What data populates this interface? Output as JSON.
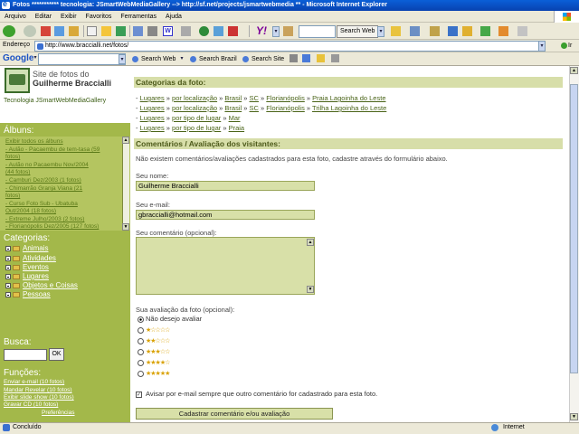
{
  "window": {
    "title": "Fotos *********** tecnologia: JSmartWebMediaGallery --> http://sf.net/projects/jsmartwebmedia ** - Microsoft Internet Explorer"
  },
  "menu": [
    "Arquivo",
    "Editar",
    "Exibir",
    "Favoritos",
    "Ferramentas",
    "Ajuda"
  ],
  "toolbar": {
    "search_button": "Search Web"
  },
  "address": {
    "label": "Endereço",
    "url": "http://www.braccialli.net/fotos/",
    "go": "Ir"
  },
  "googlebar": {
    "logo": "Google",
    "search_web": "Search Web",
    "search_brazil": "Search Brazil",
    "search_site": "Search Site"
  },
  "sidebar": {
    "site_title_line1": "Site de fotos do",
    "site_title_line2": "Guilherme Braccialli",
    "tech": "Tecnologia JSmartWebMediaGallery",
    "albums_head": "Álbuns:",
    "albums": [
      "Exibir todos os álbuns",
      "- Aulão - Pacaembu de tem-tasa (59",
      "fotos)",
      "- Aulão no Pacaembu Nov/2004",
      "(44 fotos)",
      "- Camburi Dez/2003 (1 fotos)",
      "- Chimarrão Granja Viana (21",
      "fotos)",
      "- Curso Foto Sub - Ubatuba",
      "Out/2004 (18 fotos)",
      "- Extreme Julho/2003 (2 fotos)",
      "- Florianópolis Dez/2005 (127 fotos)"
    ],
    "categories_head": "Categorias:",
    "categories": [
      "Animais",
      "Atividades",
      "Eventos",
      "Lugares",
      "Objetos e Coisas",
      "Pessoas"
    ],
    "search_head": "Busca:",
    "ok": "OK",
    "functions_head": "Funções:",
    "functions": [
      "Enviar e-mail (10 fotos)",
      "Mandar Revelar (10 fotos)",
      "Exibir slide show (10 fotos)",
      "Gravar CD (10 fotos)",
      "Preferências"
    ]
  },
  "main": {
    "categories_head": "Categorias da foto:",
    "category_paths": [
      [
        "Lugares",
        "por localização",
        "Brasil",
        "SC",
        "Florianópolis",
        "Praia Lagoinha do Leste"
      ],
      [
        "Lugares",
        "por localização",
        "Brasil",
        "SC",
        "Florianópolis",
        "Trilha Lagoinha do Leste"
      ],
      [
        "Lugares",
        "por tipo de lugar",
        "Mar"
      ],
      [
        "Lugares",
        "por tipo de lugar",
        "Praia"
      ]
    ],
    "comments_head": "Comentários / Avaliação dos visitantes:",
    "no_comments": "Não existem comentários/avaliações cadastrados para esta foto, cadastre através do formulário abaixo.",
    "name_label": "Seu nome:",
    "name_value": "Guilherme Braccialli",
    "email_label": "Seu e-mail:",
    "email_value": "gbraccialli@hotmail.com",
    "comment_label": "Seu comentário (opcional):",
    "rating_label": "Sua avaliação da foto (opcional):",
    "rating_options": [
      {
        "label": "Não desejo avaliar",
        "stars": 0
      },
      {
        "label": "",
        "stars": 1
      },
      {
        "label": "",
        "stars": 2
      },
      {
        "label": "",
        "stars": 3
      },
      {
        "label": "",
        "stars": 4
      },
      {
        "label": "",
        "stars": 5
      }
    ],
    "notify_label": "Avisar por e-mail sempre que outro comentário for cadastrado para esta foto.",
    "submit": "Cadastrar comentário e/ou avaliação"
  },
  "status": {
    "text": "Concluído",
    "zone": "Internet"
  }
}
